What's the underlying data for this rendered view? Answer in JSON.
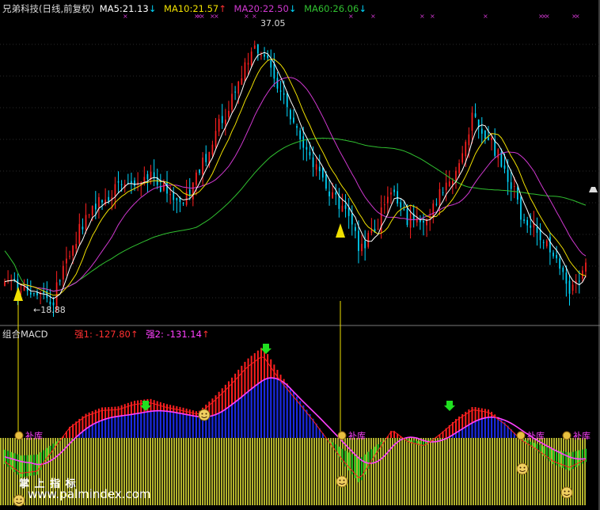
{
  "header": {
    "title": "兄弟科技(日线,前复权)",
    "ma": [
      {
        "label": "MA5:",
        "value": "21.13",
        "arrow": "↓",
        "color": "#ffffff",
        "arrow_color": "#00d8ff"
      },
      {
        "label": "MA10:",
        "value": "21.57",
        "arrow": "↑",
        "color": "#f0e000",
        "arrow_color": "#ff3030"
      },
      {
        "label": "MA20:",
        "value": "22.50",
        "arrow": "↓",
        "color": "#d038d0",
        "arrow_color": "#00d8ff"
      },
      {
        "label": "MA60:",
        "value": "26.06",
        "arrow": "↓",
        "color": "#30c030",
        "arrow_color": "#00d8ff"
      }
    ]
  },
  "price_panel": {
    "high_label": "37.05",
    "low_label": "18.88",
    "colors": {
      "up": "#ff2020",
      "down": "#00d8ff",
      "ma5": "#ffffff",
      "ma10": "#f0e000",
      "ma20": "#d038d0",
      "ma60": "#30c030",
      "signal_marks": "#d038d0",
      "arrow": "#f0e000"
    }
  },
  "macd_panel": {
    "title": "组合MACD",
    "indicators": [
      {
        "label": "强1: -127.80",
        "arrow": "↑"
      },
      {
        "label": "强2: -131.14",
        "arrow": "↑"
      }
    ],
    "badge_text": "补库",
    "colors": {
      "hist_red": "#ff2020",
      "hist_blue": "#1a2ae0",
      "hist_green": "#20c020",
      "zero_band": "#ffff40",
      "dif": "#ff2020",
      "dea": "#ff40ff",
      "green_arrow": "#20e020"
    }
  },
  "watermark": {
    "line1": "掌 上 指 标",
    "line2": "www.palmindex.com"
  },
  "chart_data": {
    "type": "candlestick",
    "title": "兄弟科技(日线,前复权)",
    "annotations": [
      {
        "text": "37.05",
        "kind": "period-high"
      },
      {
        "text": "18.88",
        "kind": "period-low"
      }
    ],
    "ma_latest": {
      "MA5": 21.13,
      "MA10": 21.57,
      "MA20": 22.5,
      "MA60": 26.06
    },
    "price_range": [
      18.88,
      37.05
    ],
    "price_trajectory": [
      20.1,
      20.0,
      19.3,
      19.2,
      22.5,
      24.5,
      26.2,
      26.5,
      27.0,
      27.4,
      26.4,
      25.6,
      27.5,
      30.5,
      32.5,
      35.5,
      36.2,
      33.5,
      31.0,
      28.5,
      26.8,
      25.2,
      22.6,
      24.0,
      27.0,
      24.5,
      24.6,
      26.2,
      28.0,
      31.5,
      30.2,
      28.0,
      25.0,
      23.5,
      22.5,
      20.0,
      21.5
    ],
    "macd": {
      "indicators": [
        {
          "name": "强1",
          "value": -127.8
        },
        {
          "name": "强2",
          "value": -131.14
        }
      ],
      "hist_trajectory": [
        -0.6,
        -0.9,
        -0.85,
        -0.3,
        0.25,
        0.55,
        0.7,
        0.72,
        0.85,
        0.9,
        0.78,
        0.7,
        0.6,
        0.95,
        1.35,
        1.8,
        2.1,
        1.5,
        1.0,
        0.5,
        -0.05,
        -0.6,
        -1.05,
        -0.4,
        0.2,
        -0.1,
        -0.2,
        0.1,
        0.45,
        0.72,
        0.65,
        0.35,
        -0.05,
        -0.3,
        -0.6,
        -0.75,
        -0.55
      ]
    }
  }
}
